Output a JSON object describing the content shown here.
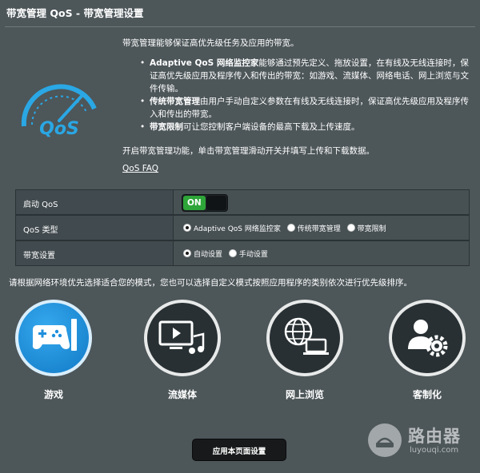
{
  "page": {
    "title": "带宽管理 QoS - 带宽管理设置"
  },
  "intro": {
    "text": "带宽管理能够保证高优先级任务及应用的带宽。",
    "bullets": [
      {
        "highlight": "Adaptive QoS 网络监控家",
        "text": "能够通过预先定义、拖放设置，在有线及无线连接时，保证高优先级应用及程序传入和传出的带宽：如游戏、流媒体、网络电话、网上浏览与文件传输。"
      },
      {
        "highlight": "传统带宽管理",
        "text": "由用户手动自定义参数在有线及无线连接时，保证高优先级应用及程序传入和传出的带宽。"
      },
      {
        "highlight": "带宽限制",
        "text": "可让您控制客户端设备的最高下载及上传速度。"
      }
    ],
    "hint": "开启带宽管理功能，单击带宽管理滑动开关并填写上传和下载数据。",
    "faq_link": "QoS FAQ"
  },
  "logo": {
    "text": "QoS"
  },
  "settings": {
    "enable_label": "启动 QoS",
    "enable_state": "ON",
    "type_label": "QoS 类型",
    "type_options": [
      "Adaptive QoS 网络监控家",
      "传统带宽管理",
      "带宽限制"
    ],
    "type_selected": 0,
    "bandwidth_label": "带宽设置",
    "bandwidth_options": [
      "自动设置",
      "手动设置"
    ],
    "bandwidth_selected": 0
  },
  "modes": {
    "hint": "请根据网络环境优先选择适合您的模式，您也可以选择自定义模式按照应用程序的类别依次进行优先级排序。",
    "items": [
      {
        "label": "游戏",
        "icon": "gamepad-icon",
        "active": true
      },
      {
        "label": "流媒体",
        "icon": "media-player-icon",
        "active": false
      },
      {
        "label": "网上浏览",
        "icon": "web-browsing-icon",
        "active": false
      },
      {
        "label": "客制化",
        "icon": "user-gear-icon",
        "active": false
      }
    ]
  },
  "apply_button": "应用本页面设置",
  "watermark": {
    "main": "路由器",
    "sub": "luyouqi.com"
  },
  "colors": {
    "background": "#4d5659",
    "toggle_on": "#2ea538",
    "active_mode": "#1f8fdc",
    "logo_blue": "#2aa7e4"
  }
}
